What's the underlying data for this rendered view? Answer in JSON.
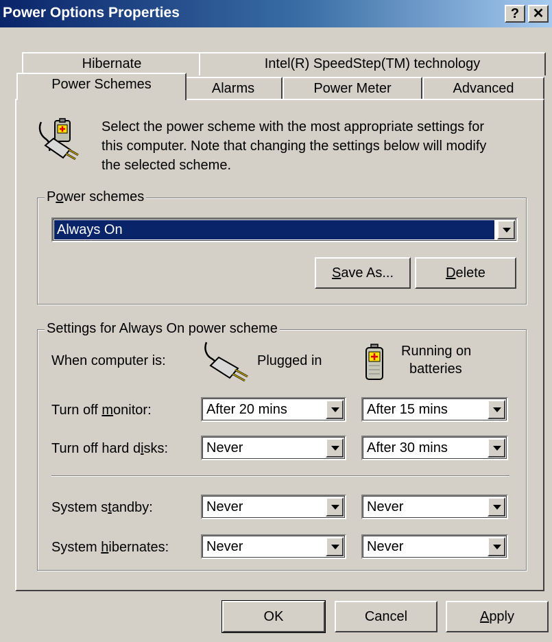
{
  "window": {
    "title": "Power Options Properties",
    "help_label": "?",
    "close_label": "✕"
  },
  "tabs": {
    "row1": [
      "Hibernate",
      "Intel(R) SpeedStep(TM) technology"
    ],
    "row2": [
      "Power Schemes",
      "Alarms",
      "Power Meter",
      "Advanced"
    ],
    "active": "Power Schemes"
  },
  "intro": {
    "line1": "Select the power scheme with the most appropriate settings for",
    "line2": "this computer. Note that changing the settings below will modify",
    "line3": "the selected scheme."
  },
  "power_schemes": {
    "legend_pre": "P",
    "legend_u": "o",
    "legend_post": "wer schemes",
    "selected": "Always On",
    "save_as_u": "S",
    "save_as_rest": "ave As...",
    "delete_u": "D",
    "delete_rest": "elete"
  },
  "settings": {
    "legend": "Settings for Always On power scheme",
    "when_label": "When computer is:",
    "plugged_in": "Plugged in",
    "running_on_1": "Running on",
    "running_on_2": "batteries",
    "rows": {
      "monitor": {
        "label_pre": "Turn off ",
        "label_u": "m",
        "label_post": "onitor:",
        "plugged": "After 20 mins",
        "battery": "After 15 mins"
      },
      "disks": {
        "label_pre": "Turn off hard d",
        "label_u": "i",
        "label_post": "sks:",
        "plugged": "Never",
        "battery": "After 30 mins"
      },
      "standby": {
        "label_pre": "System s",
        "label_u": "t",
        "label_post": "andby:",
        "plugged": "Never",
        "battery": "Never"
      },
      "hibernate": {
        "label_pre": "System ",
        "label_u": "h",
        "label_post": "ibernates:",
        "plugged": "Never",
        "battery": "Never"
      }
    }
  },
  "footer": {
    "ok": "OK",
    "cancel": "Cancel",
    "apply_u": "A",
    "apply_rest": "pply"
  },
  "colors": {
    "titlebar_start": "#0a246a",
    "titlebar_end": "#a6caf0",
    "face": "#d4d0c8",
    "selection": "#0a246a"
  }
}
